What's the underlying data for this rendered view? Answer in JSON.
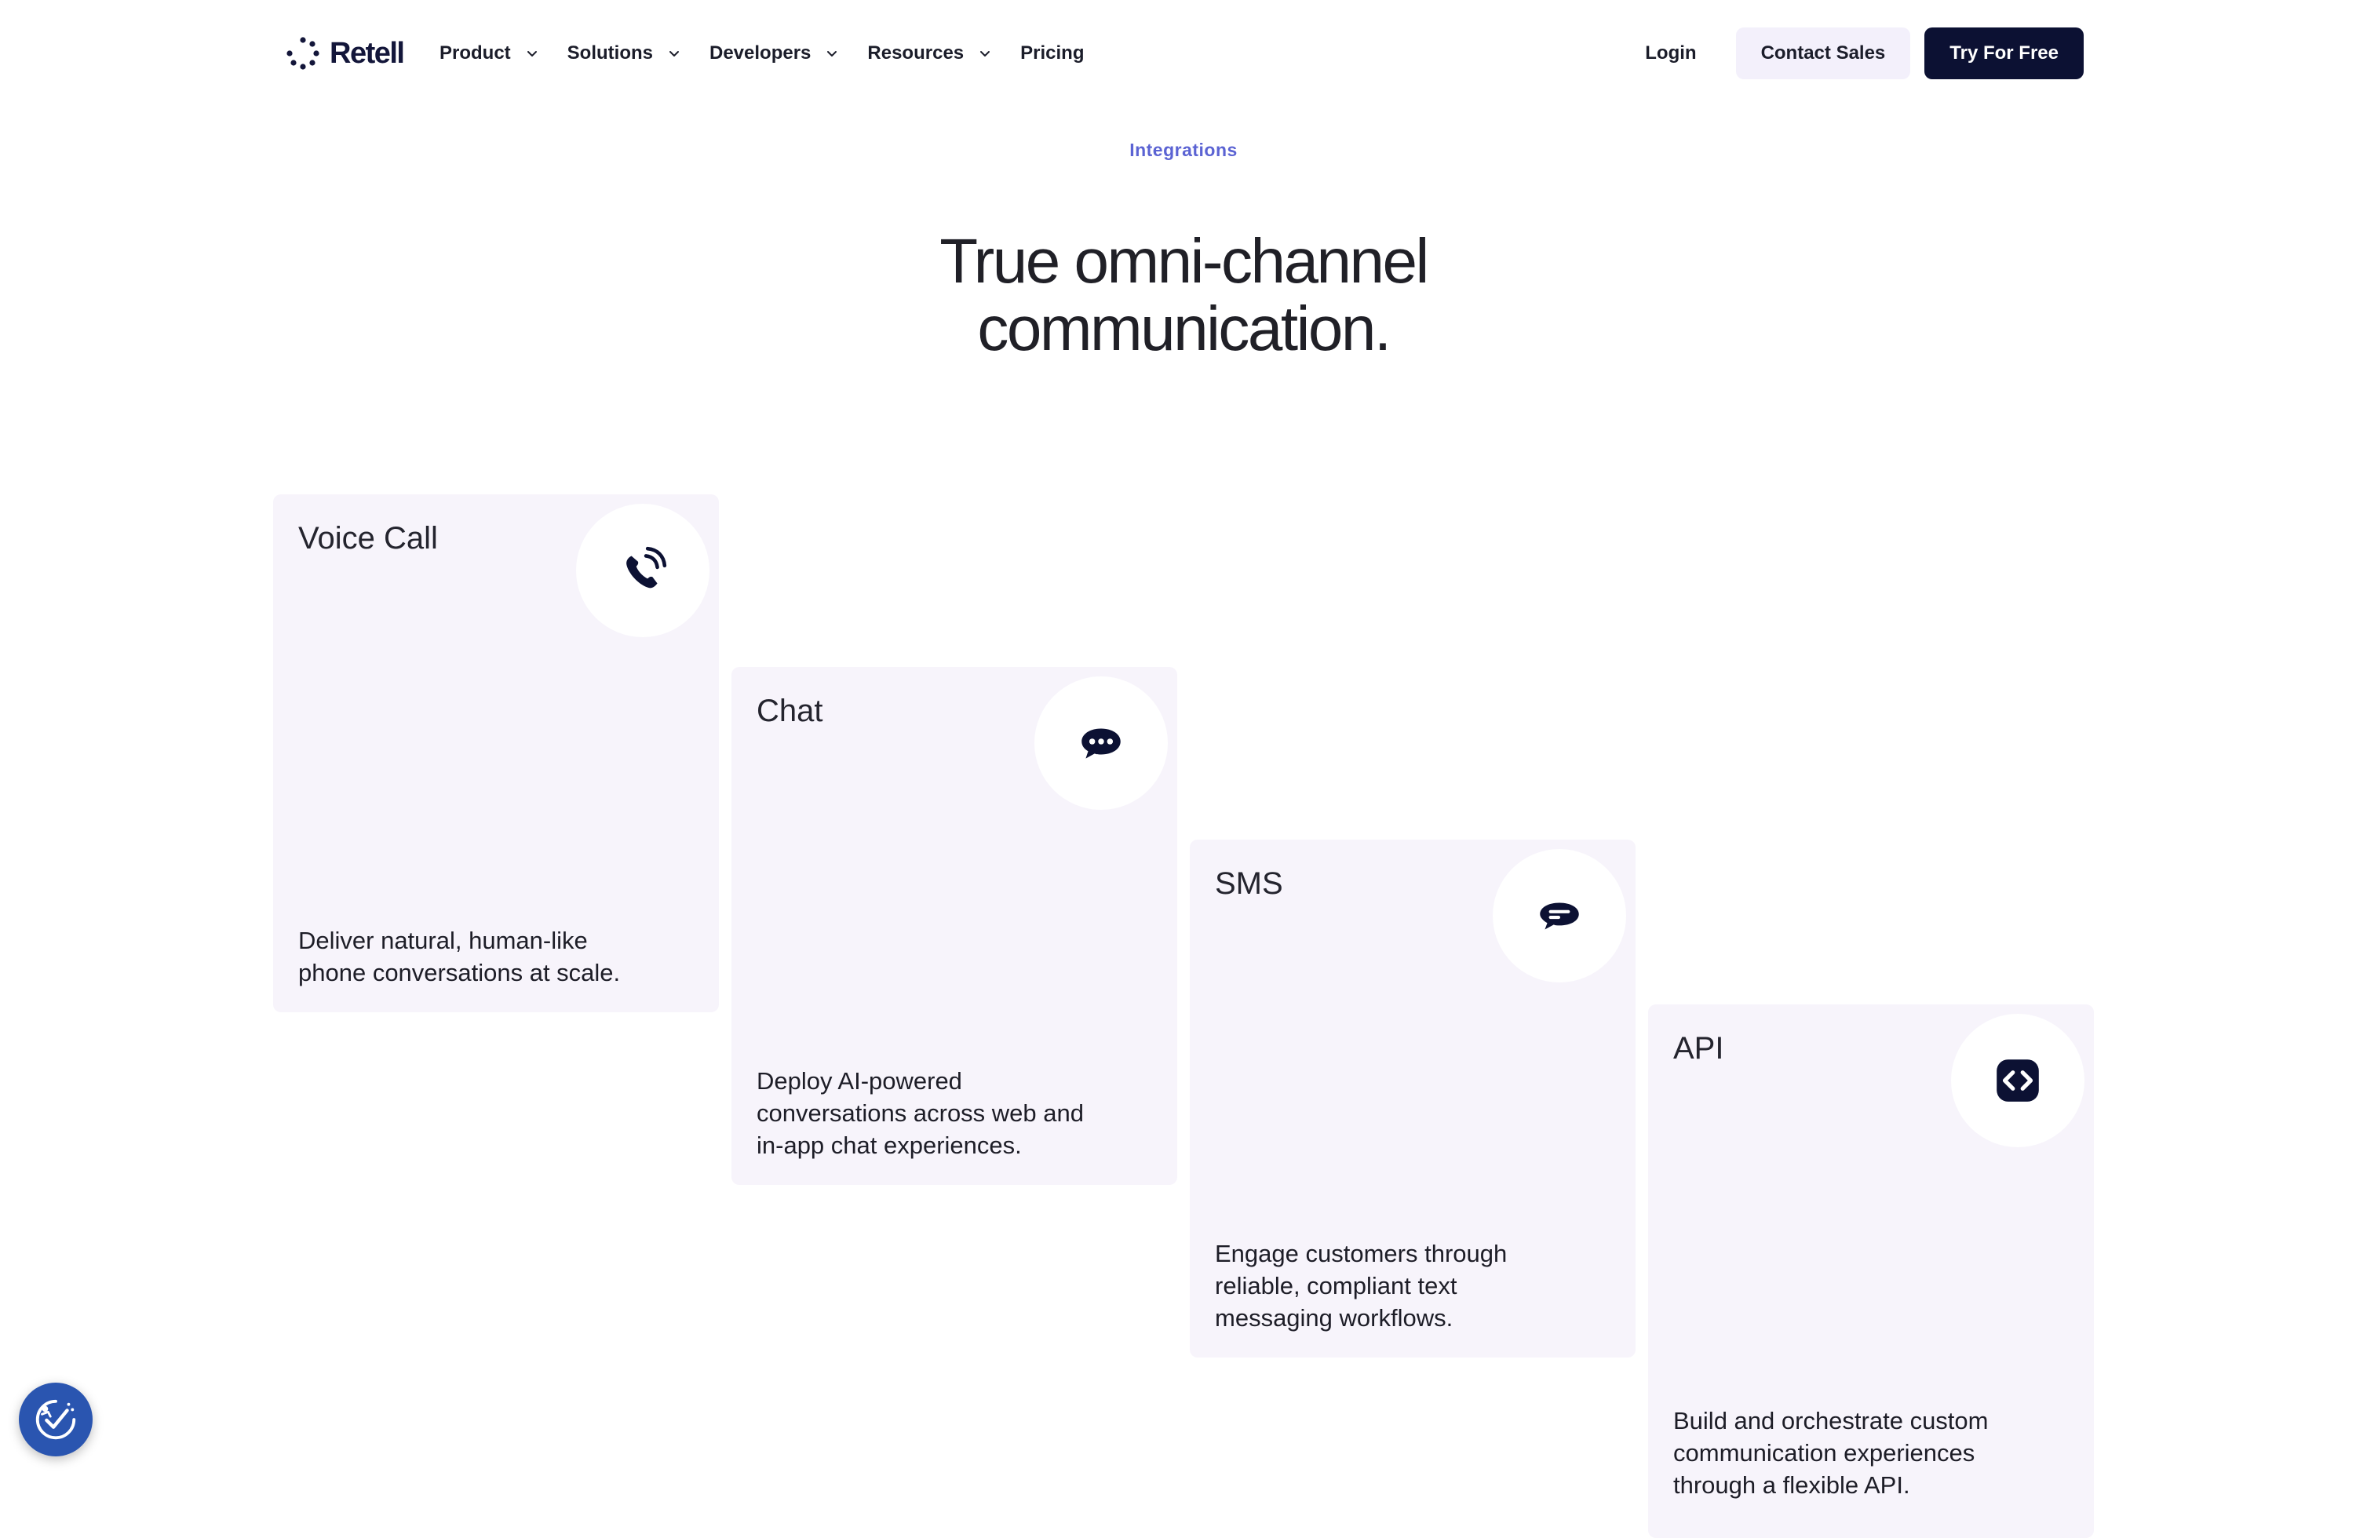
{
  "nav": {
    "logo_text": "Retell",
    "items": [
      {
        "label": "Product",
        "has_dropdown": true
      },
      {
        "label": "Solutions",
        "has_dropdown": true
      },
      {
        "label": "Developers",
        "has_dropdown": true
      },
      {
        "label": "Resources",
        "has_dropdown": true
      },
      {
        "label": "Pricing",
        "has_dropdown": false
      }
    ],
    "login_label": "Login",
    "contact_label": "Contact Sales",
    "try_label": "Try For Free"
  },
  "hero": {
    "eyebrow": "Integrations",
    "title_line1": "True omni-channel",
    "title_line2": "communication."
  },
  "cards": [
    {
      "title": "Voice Call",
      "icon": "phone-icon",
      "description": "Deliver natural, human-like phone conversations at scale."
    },
    {
      "title": "Chat",
      "icon": "chat-bubble-icon",
      "description": "Deploy AI-powered conversations across web and in-app chat experiences."
    },
    {
      "title": "SMS",
      "icon": "sms-message-icon",
      "description": "Engage customers through reliable, compliant text messaging workflows."
    },
    {
      "title": "API",
      "icon": "code-brackets-icon",
      "description": "Build and orchestrate custom communication experiences through a flexible API."
    }
  ],
  "accessibility_button": {
    "icon": "accessibility-check-icon"
  },
  "colors": {
    "brand_dark": "#0c1133",
    "accent": "#5b63d3",
    "card_bg": "#f7f4fb",
    "contact_bg": "#f3f0fb",
    "fab_bg": "#2a55b0"
  }
}
